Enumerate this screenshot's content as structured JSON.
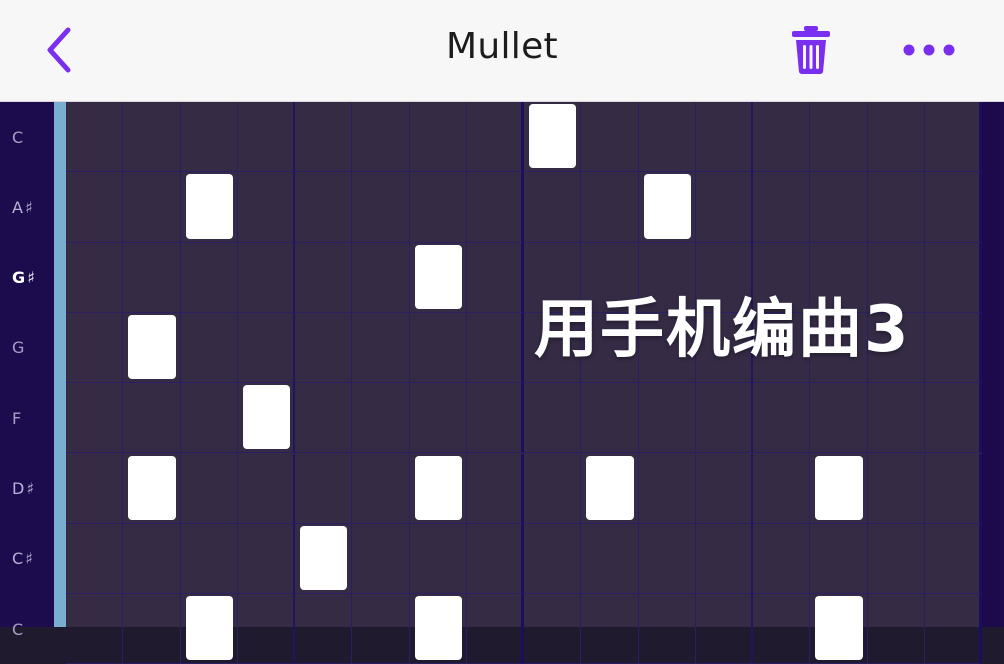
{
  "header": {
    "title": "Mullet",
    "back_icon": "chevron-left-icon",
    "trash_icon": "trash-icon",
    "more_icon": "more-horizontal-icon",
    "accent_color": "#7a2ff0"
  },
  "piano_roll": {
    "rows": [
      "C",
      "A♯",
      "G♯",
      "G",
      "F",
      "D♯",
      "C♯",
      "C"
    ],
    "highlighted_row": 2,
    "step_count": 16,
    "notes": [
      {
        "row": 0,
        "step": 8
      },
      {
        "row": 1,
        "step": 2
      },
      {
        "row": 1,
        "step": 10
      },
      {
        "row": 2,
        "step": 6
      },
      {
        "row": 3,
        "step": 1
      },
      {
        "row": 4,
        "step": 3
      },
      {
        "row": 5,
        "step": 1
      },
      {
        "row": 5,
        "step": 6
      },
      {
        "row": 5,
        "step": 9
      },
      {
        "row": 5,
        "step": 13
      },
      {
        "row": 6,
        "step": 4
      },
      {
        "row": 7,
        "step": 2
      },
      {
        "row": 7,
        "step": 6
      },
      {
        "row": 7,
        "step": 13
      }
    ],
    "colors": {
      "cell_bg": "#352b45",
      "grid_line": "#2a1f62",
      "note": "#ffffff",
      "key_column": "#1c0c4e",
      "playhead": "#7aaed1"
    }
  },
  "overlay": {
    "caption": "用手机编曲3"
  }
}
